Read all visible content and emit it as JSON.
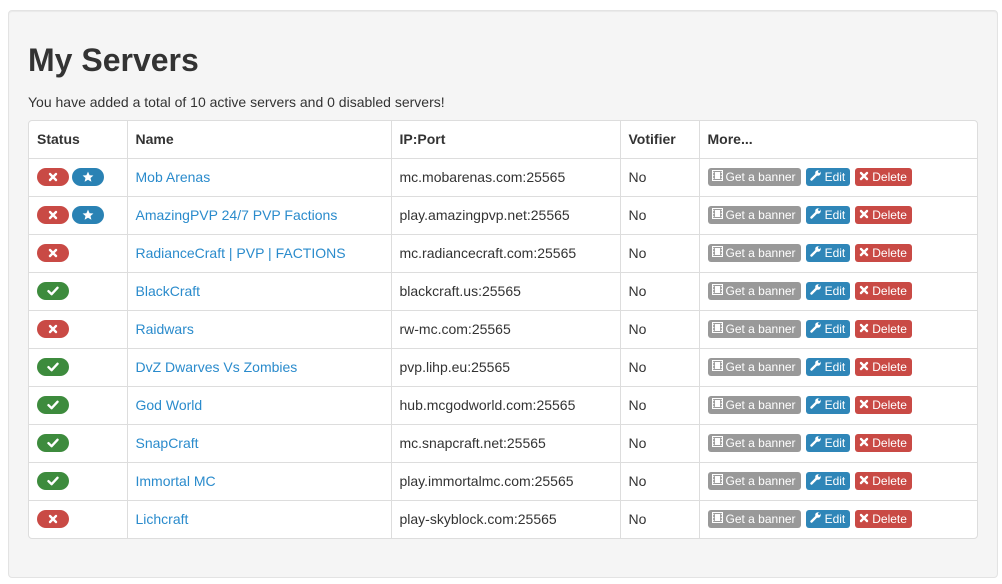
{
  "page": {
    "title": "My Servers",
    "summary": "You have added a total of 10 active servers and 0 disabled servers!"
  },
  "table": {
    "headers": [
      "Status",
      "Name",
      "IP:Port",
      "Votifier",
      "More..."
    ],
    "actions": {
      "banner_label": "Get a banner",
      "edit_label": "Edit",
      "delete_label": "Delete"
    },
    "rows": [
      {
        "online": false,
        "featured": true,
        "name": "Mob Arenas",
        "ip": "mc.mobarenas.com:25565",
        "votifier": "No"
      },
      {
        "online": false,
        "featured": true,
        "name": "AmazingPVP 24/7 PVP Factions",
        "ip": "play.amazingpvp.net:25565",
        "votifier": "No"
      },
      {
        "online": false,
        "featured": false,
        "name": "RadianceCraft | PVP | FACTIONS",
        "ip": "mc.radiancecraft.com:25565",
        "votifier": "No"
      },
      {
        "online": true,
        "featured": false,
        "name": "BlackCraft",
        "ip": "blackcraft.us:25565",
        "votifier": "No"
      },
      {
        "online": false,
        "featured": false,
        "name": "Raidwars",
        "ip": "rw-mc.com:25565",
        "votifier": "No"
      },
      {
        "online": true,
        "featured": false,
        "name": "DvZ Dwarves Vs Zombies",
        "ip": "pvp.lihp.eu:25565",
        "votifier": "No"
      },
      {
        "online": true,
        "featured": false,
        "name": "God World",
        "ip": "hub.mcgodworld.com:25565",
        "votifier": "No"
      },
      {
        "online": true,
        "featured": false,
        "name": "SnapCraft",
        "ip": "mc.snapcraft.net:25565",
        "votifier": "No"
      },
      {
        "online": true,
        "featured": false,
        "name": "Immortal MC",
        "ip": "play.immortalmc.com:25565",
        "votifier": "No"
      },
      {
        "online": false,
        "featured": false,
        "name": "Lichcraft",
        "ip": "play-skyblock.com:25565",
        "votifier": "No"
      }
    ]
  },
  "icons": {
    "offline": "x-icon",
    "online": "check-icon",
    "featured": "star-icon",
    "banner": "film-icon",
    "edit": "wrench-icon",
    "delete": "x-icon"
  },
  "colors": {
    "offline": "#c94a45",
    "online": "#3d8b3d",
    "featured": "#2a82b4",
    "link": "#2a8bcc",
    "banner_button": "#999999",
    "edit_button": "#2f86b8",
    "delete_button": "#c94a45"
  }
}
